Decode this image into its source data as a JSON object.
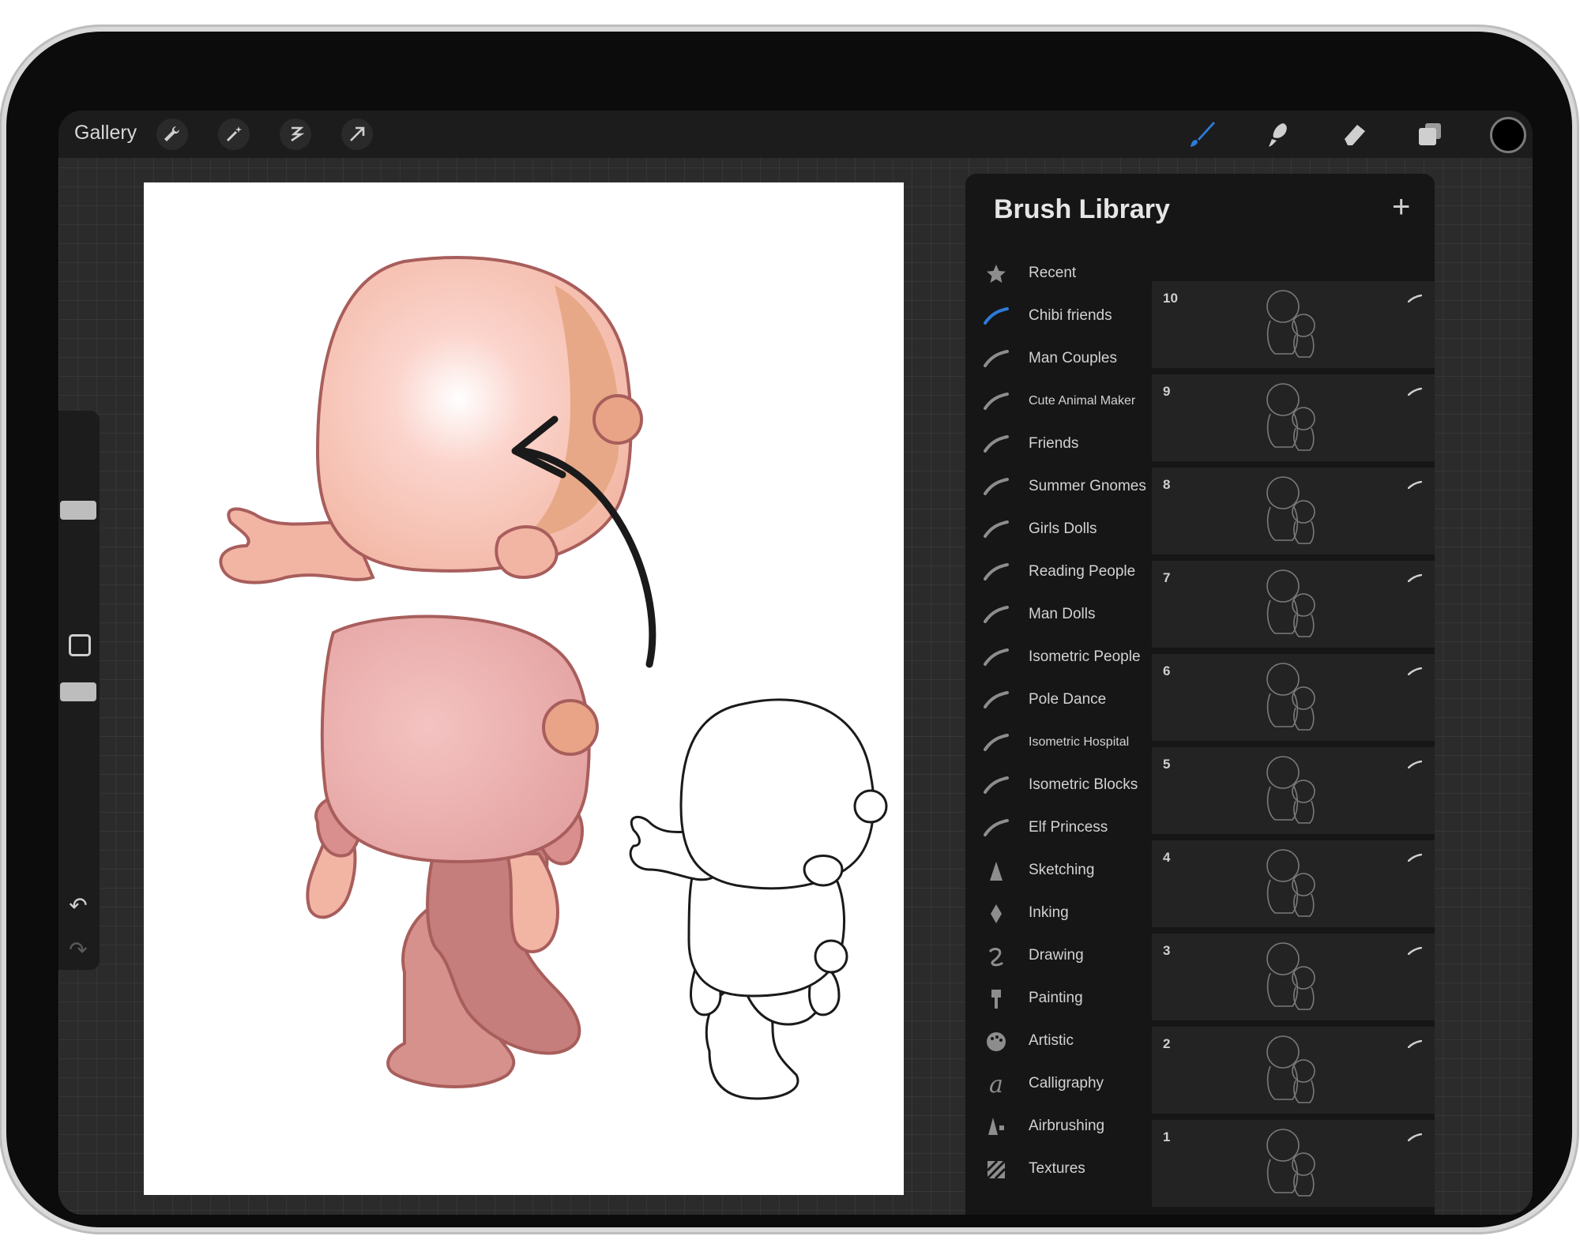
{
  "toolbar": {
    "gallery_label": "Gallery",
    "left_tools": [
      "wrench-icon",
      "magic-wand-icon",
      "selection-icon",
      "move-arrow-icon"
    ],
    "right_tools": [
      "brush-icon",
      "smudge-icon",
      "eraser-icon",
      "layers-icon"
    ],
    "active_tool": "brush-icon",
    "active_tool_color": "#2d7bd8",
    "current_color": "#000000"
  },
  "sidebar": {
    "brush_size_level": 0.2,
    "opacity_level": 0.3,
    "controls": [
      "modify-icon",
      "undo-icon",
      "redo-icon"
    ]
  },
  "brush_library": {
    "title": "Brush Library",
    "add_label": "+",
    "active_set": "Chibi friends",
    "sets": [
      {
        "label": "Recent",
        "icon": "star-icon"
      },
      {
        "label": "Chibi friends",
        "icon": "brush-stroke-icon"
      },
      {
        "label": "Man Couples",
        "icon": "brush-stroke-icon"
      },
      {
        "label": "Cute Animal Maker",
        "icon": "brush-stroke-icon"
      },
      {
        "label": "Friends",
        "icon": "brush-stroke-icon"
      },
      {
        "label": "Summer Gnomes",
        "icon": "brush-stroke-icon"
      },
      {
        "label": "Girls Dolls",
        "icon": "brush-stroke-icon"
      },
      {
        "label": "Reading People",
        "icon": "brush-stroke-icon"
      },
      {
        "label": "Man Dolls",
        "icon": "brush-stroke-icon"
      },
      {
        "label": "Isometric People",
        "icon": "brush-stroke-icon"
      },
      {
        "label": "Pole Dance",
        "icon": "brush-stroke-icon"
      },
      {
        "label": "Isometric Hospital",
        "icon": "brush-stroke-icon"
      },
      {
        "label": "Isometric Blocks",
        "icon": "brush-stroke-icon"
      },
      {
        "label": "Elf Princess",
        "icon": "brush-stroke-icon"
      },
      {
        "label": "Sketching",
        "icon": "pencil-tip-icon"
      },
      {
        "label": "Inking",
        "icon": "pen-nib-icon"
      },
      {
        "label": "Drawing",
        "icon": "squiggle-icon"
      },
      {
        "label": "Painting",
        "icon": "paint-brush-icon"
      },
      {
        "label": "Artistic",
        "icon": "palette-icon"
      },
      {
        "label": "Calligraphy",
        "icon": "calligraphy-icon"
      },
      {
        "label": "Airbrushing",
        "icon": "airbrush-icon"
      },
      {
        "label": "Textures",
        "icon": "texture-icon"
      }
    ],
    "brushes": [
      "10",
      "9",
      "8",
      "7",
      "6",
      "5",
      "4",
      "3",
      "2",
      "1"
    ]
  }
}
